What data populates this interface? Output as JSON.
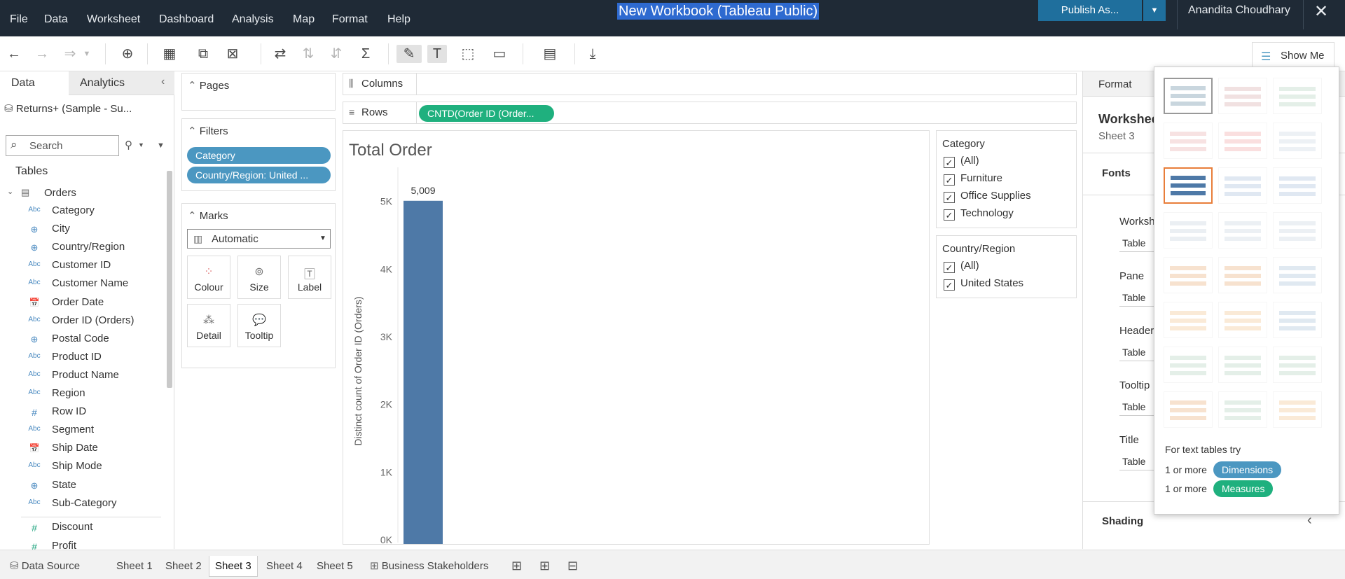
{
  "menubar": {
    "items": [
      "File",
      "Data",
      "Worksheet",
      "Dashboard",
      "Analysis",
      "Map",
      "Format",
      "Help"
    ],
    "workbook_title": "New Workbook (Tableau Public)",
    "publish_label": "Publish As...",
    "user_name": "Anandita Choudhary"
  },
  "toolbar": {
    "show_me_label": "Show Me"
  },
  "data_pane": {
    "tab_data": "Data",
    "tab_analytics": "Analytics",
    "datasource": "Returns+ (Sample - Su...",
    "search_placeholder": "Search",
    "tables_header": "Tables",
    "table_name": "Orders",
    "fields": [
      {
        "type": "abc",
        "label": "Category"
      },
      {
        "type": "geo",
        "label": "City"
      },
      {
        "type": "geo",
        "label": "Country/Region"
      },
      {
        "type": "abc",
        "label": "Customer ID"
      },
      {
        "type": "abc",
        "label": "Customer Name"
      },
      {
        "type": "date",
        "label": "Order Date"
      },
      {
        "type": "abc",
        "label": "Order ID (Orders)"
      },
      {
        "type": "geo",
        "label": "Postal Code"
      },
      {
        "type": "abc",
        "label": "Product ID"
      },
      {
        "type": "abc",
        "label": "Product Name"
      },
      {
        "type": "abc",
        "label": "Region"
      },
      {
        "type": "num",
        "label": "Row ID"
      },
      {
        "type": "abc",
        "label": "Segment"
      },
      {
        "type": "date",
        "label": "Ship Date"
      },
      {
        "type": "abc",
        "label": "Ship Mode"
      },
      {
        "type": "geo",
        "label": "State"
      },
      {
        "type": "abc",
        "label": "Sub-Category"
      }
    ],
    "measures": [
      {
        "type": "meas",
        "label": "Discount"
      },
      {
        "type": "meas",
        "label": "Profit"
      }
    ]
  },
  "shelves": {
    "pages": "Pages",
    "filters": "Filters",
    "filter_pills": [
      "Category",
      "Country/Region: United ..."
    ],
    "marks": "Marks",
    "mark_type": "Automatic",
    "mark_buttons": [
      "Colour",
      "Size",
      "Label",
      "Detail",
      "Tooltip"
    ],
    "columns": "Columns",
    "rows": "Rows",
    "rows_pill": "CNTD(Order ID (Order..."
  },
  "view": {
    "title": "Total Order"
  },
  "chart_data": {
    "type": "bar",
    "categories": [
      ""
    ],
    "values": [
      5009
    ],
    "data_labels": [
      "5,009"
    ],
    "title": "Total Order",
    "xlabel": "",
    "ylabel": "Distinct count of Order ID (Orders)",
    "ylim": [
      0,
      5400
    ],
    "yticks": [
      0,
      1000,
      2000,
      3000,
      4000,
      5000
    ],
    "ytick_labels": [
      "0K",
      "1K",
      "2K",
      "3K",
      "4K",
      "5K"
    ],
    "bar_color": "#4e79a7",
    "grid": false
  },
  "legends": {
    "category": {
      "title": "Category",
      "items": [
        "(All)",
        "Furniture",
        "Office Supplies",
        "Technology"
      ]
    },
    "country": {
      "title": "Country/Region",
      "items": [
        "(All)",
        "United States"
      ]
    }
  },
  "format_pane": {
    "header": "Format",
    "worksheet": "Workshee",
    "sheet": "Sheet 3",
    "fonts": "Fonts",
    "rows": [
      {
        "label": "Worksh",
        "value": "Table"
      },
      {
        "label": "Pane",
        "value": "Table"
      },
      {
        "label": "Header",
        "value": "Table"
      },
      {
        "label": "Tooltip",
        "value": "Table"
      },
      {
        "label": "Title",
        "value": "Table"
      }
    ],
    "shading": "Shading"
  },
  "show_me": {
    "hint": "For text tables try",
    "dimensions_prefix": "1 or more",
    "dimensions_label": "Dimensions",
    "measures_prefix": "1 or more",
    "measures_label": "Measures"
  },
  "bottom_tabs": [
    "Data Source",
    "Sheet 1",
    "Sheet 2",
    "Sheet 3",
    "Sheet 4",
    "Sheet 5",
    "Business Stakeholders"
  ],
  "active_tab": "Sheet 3",
  "colors": {
    "accent": "#1f6f9d",
    "dimension_pill": "#4b97c1",
    "measure_pill": "#1fb07e",
    "bar": "#4e79a7",
    "menubar": "#1f2a36"
  }
}
